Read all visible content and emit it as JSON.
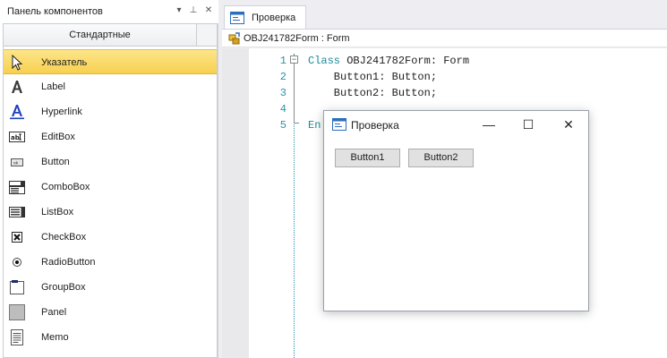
{
  "panel": {
    "title": "Панель компонентов",
    "header_buttons": [
      "▾",
      "⊥",
      "✕"
    ],
    "group_tab": "Стандартные",
    "items": [
      {
        "label": "Указатель",
        "icon": "pointer-icon",
        "selected": true
      },
      {
        "label": "Label",
        "icon": "label-icon"
      },
      {
        "label": "Hyperlink",
        "icon": "hyperlink-icon"
      },
      {
        "label": "EditBox",
        "icon": "editbox-icon"
      },
      {
        "label": "Button",
        "icon": "button-icon"
      },
      {
        "label": "ComboBox",
        "icon": "combobox-icon"
      },
      {
        "label": "ListBox",
        "icon": "listbox-icon"
      },
      {
        "label": "CheckBox",
        "icon": "checkbox-icon"
      },
      {
        "label": "RadioButton",
        "icon": "radiobutton-icon"
      },
      {
        "label": "GroupBox",
        "icon": "groupbox-icon"
      },
      {
        "label": "Panel",
        "icon": "panel-icon"
      },
      {
        "label": "Memo",
        "icon": "memo-icon"
      }
    ]
  },
  "document": {
    "tab_label": "Проверка",
    "class_bar": "OBJ241782Form : Form",
    "line_numbers": [
      "1",
      "2",
      "3",
      "4",
      "5"
    ],
    "code": {
      "line1_kw": "Class",
      "line1_rest": " OBJ241782Form: Form",
      "line2": "    Button1: Button;",
      "line3": "    Button2: Button;",
      "line4": "",
      "line5_kw": "En"
    }
  },
  "form_window": {
    "title": "Проверка",
    "minimize": "—",
    "maximize": "☐",
    "close": "✕",
    "buttons": [
      "Button1",
      "Button2"
    ]
  },
  "colors": {
    "selected_item": "#f7d04f",
    "keyword": "#1a8a9a",
    "line_numbers": "#2b91af"
  }
}
